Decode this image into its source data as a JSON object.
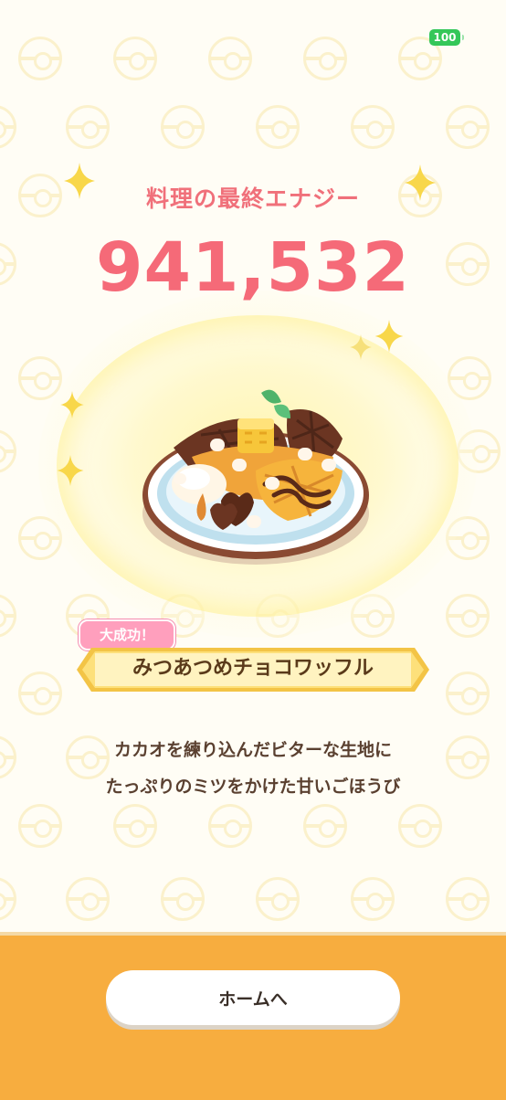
{
  "status_bar": {
    "battery": "100",
    "battery_color": "#34c759"
  },
  "result": {
    "title": "料理の最終エナジー",
    "energy": "941,532",
    "title_color": "#f0707a",
    "energy_color": "#f56a78"
  },
  "dish": {
    "image": "chocolate-waffle-dish",
    "badge": "大成功！",
    "name": "みつあつめチョコワッフル",
    "description_line1": "カカオを練り込んだビターな生地に",
    "description_line2": "たっぷりのミツをかけた甘いごほうび"
  },
  "footer": {
    "home_button": "ホームへ",
    "background_color": "#f7ad3f"
  }
}
